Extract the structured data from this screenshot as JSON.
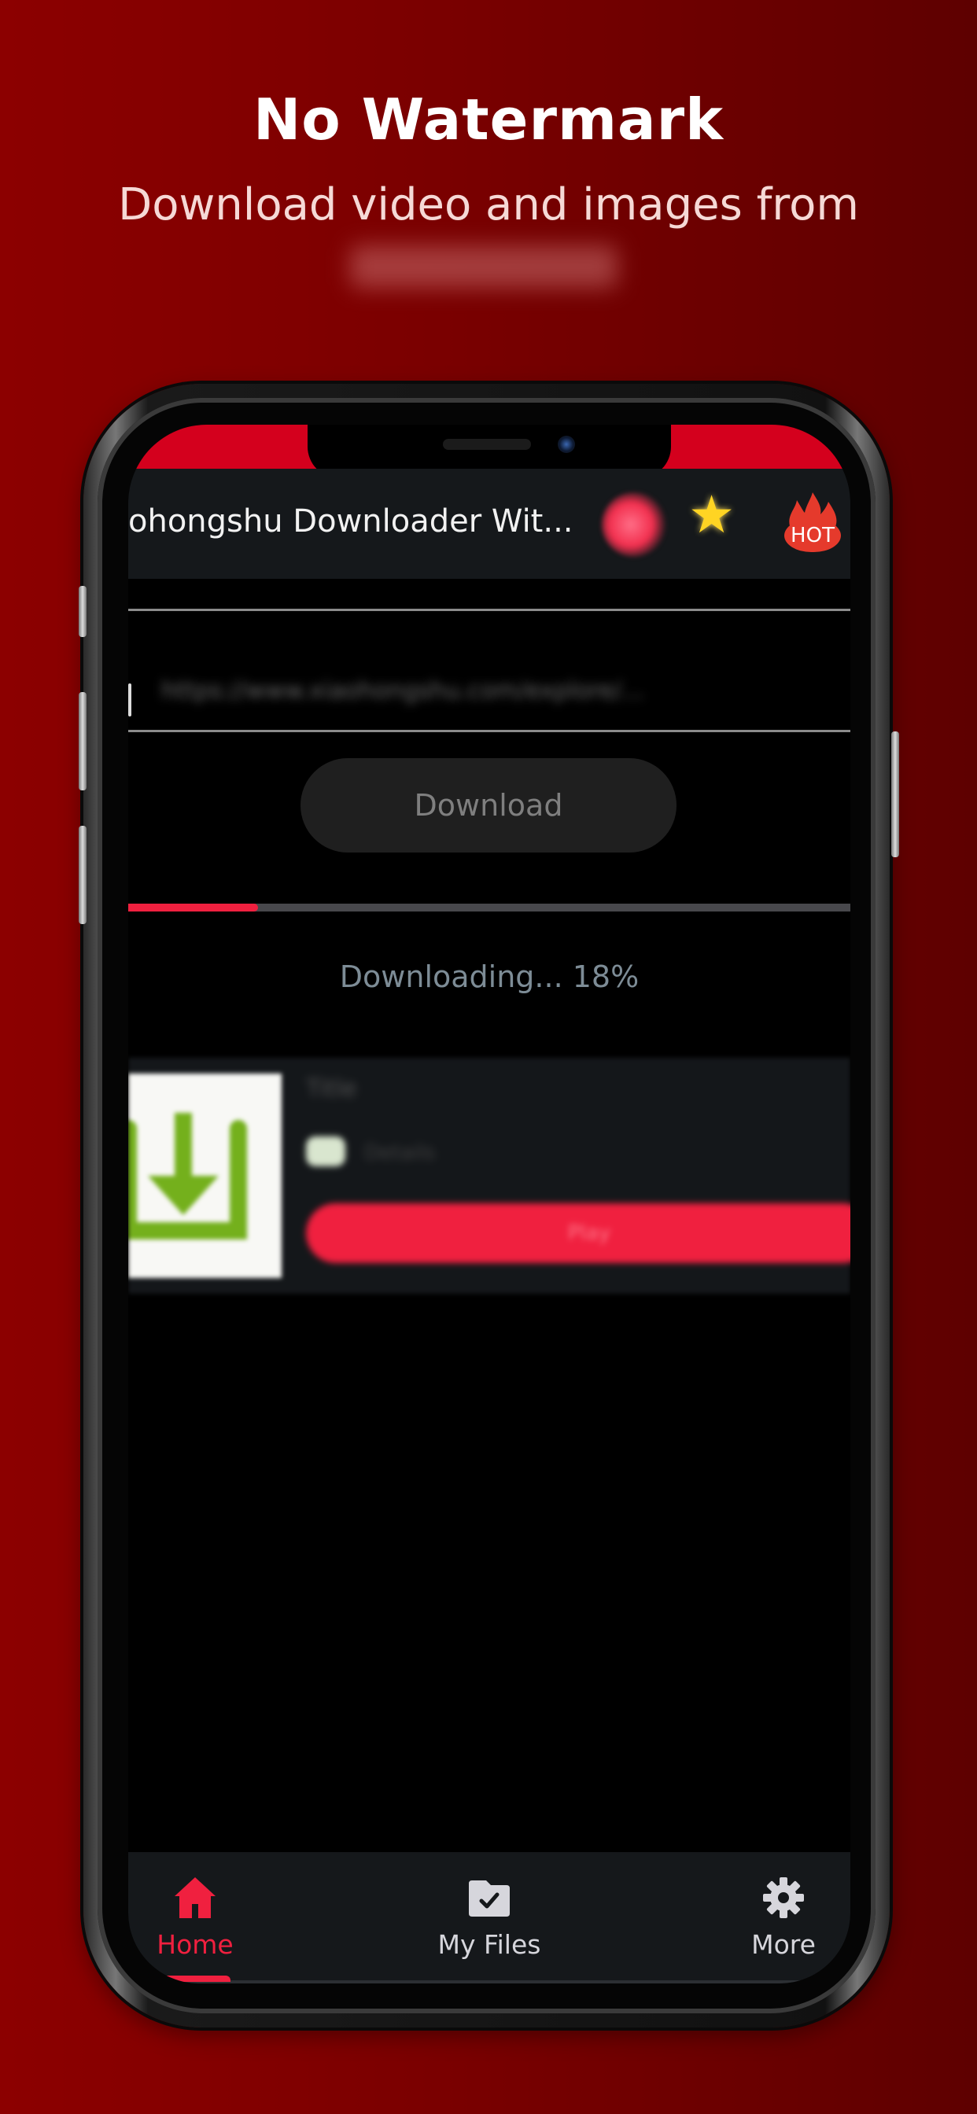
{
  "promo": {
    "title": "No Watermark",
    "subtitle": "Download video and images from",
    "subtitle_second_line_blurred": true
  },
  "app": {
    "title": "ohongshu Downloader Wit...",
    "header_icons": [
      "record-dot-icon",
      "star-face-icon",
      "hot-fire-icon"
    ],
    "hot_badge_label": "HOT"
  },
  "url_input": {
    "value_blurred": "https://www.xiaohongshu.com/explore/...",
    "placeholder": ""
  },
  "download_button": {
    "label": "Download"
  },
  "progress": {
    "percent": 18,
    "label": "Downloading... 18%"
  },
  "file_card": {
    "title_blurred": "Title",
    "meta_blurred": "Details",
    "action_blurred": "Play",
    "thumbnail_icon": "download-tray-icon"
  },
  "bottom_nav": {
    "items": [
      {
        "label": "Home",
        "icon": "home-icon",
        "active": true
      },
      {
        "label": "My Files",
        "icon": "folder-check-icon",
        "active": false
      },
      {
        "label": "More",
        "icon": "gear-icon",
        "active": false
      }
    ]
  },
  "colors": {
    "accent": "#f0203f",
    "status_bar": "#d4001d",
    "background_gradient_start": "#8c0000",
    "background_gradient_end": "#5e0000",
    "header_bg": "#15181b",
    "inactive_icon": "#d6d6dc",
    "progress_text": "#7d8c96"
  }
}
